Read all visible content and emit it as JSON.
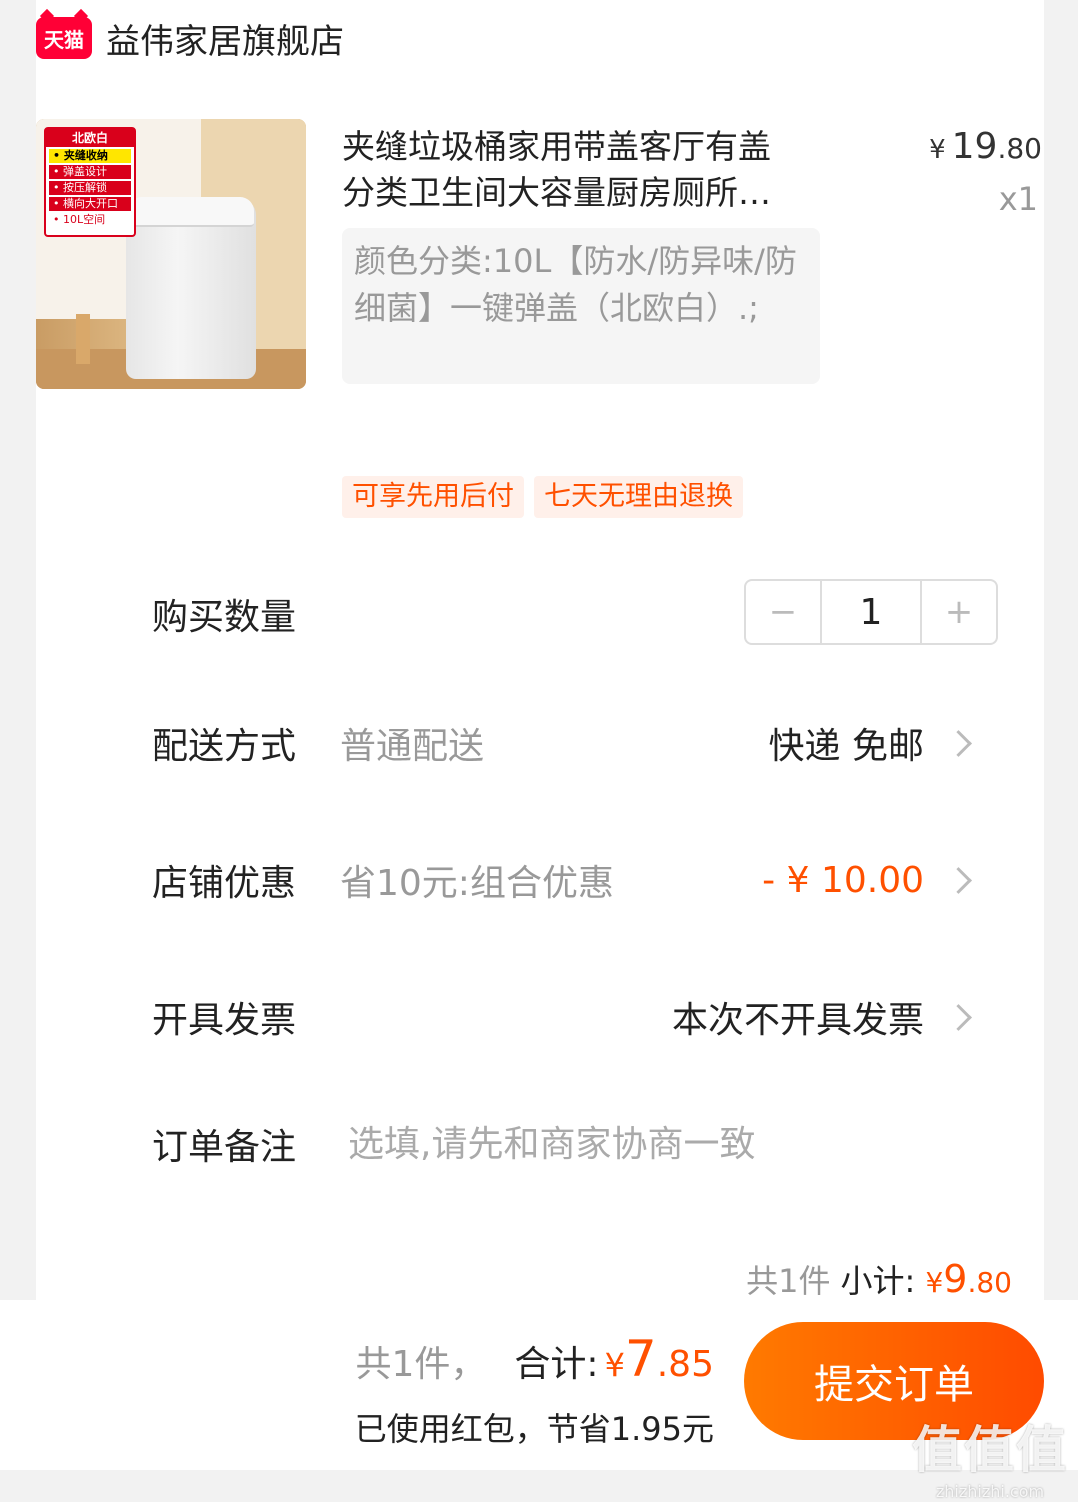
{
  "store": {
    "logo_text": "天猫",
    "name": "益伟家居旗舰店"
  },
  "product": {
    "image_tag": {
      "title": "北欧白",
      "lines": [
        "• 夹缝收纳",
        "• 弹盖设计",
        "• 按压解锁",
        "• 横向大开口",
        "• 10L空间"
      ]
    },
    "title_line1": "夹缝垃圾桶家用带盖客厅有盖",
    "title_line2": "分类卫生间大容量厨房厕所…",
    "price_currency": "¥",
    "price_int": "19",
    "price_dec": ".80",
    "quantity_label": "x1",
    "sku": "颜色分类:10L【防水/防异味/防细菌】一键弹盖（北欧白）.;",
    "tags": [
      "可享先用后付",
      "七天无理由退换"
    ]
  },
  "quantity": {
    "label": "购买数量",
    "minus": "−",
    "value": "1",
    "plus": "+"
  },
  "delivery": {
    "label": "配送方式",
    "desc": "普通配送",
    "value": "快递 免邮"
  },
  "discount": {
    "label": "店铺优惠",
    "desc": "省10元:组合优惠",
    "value": "- ¥ 10.00"
  },
  "invoice": {
    "label": "开具发票",
    "value": "本次不开具发票"
  },
  "note": {
    "label": "订单备注",
    "placeholder": "选填,请先和商家协商一致"
  },
  "subtotal": {
    "count": "共1件",
    "label": "小计:",
    "currency": "¥",
    "int": "9",
    "dec": ".80"
  },
  "footer": {
    "count": "共1件，",
    "total_label": "合计:",
    "currency": "¥",
    "int": "7",
    "dec": ".85",
    "savings": "已使用红包，节省1.95元",
    "submit": "提交订单"
  },
  "watermark": {
    "big": "值值值",
    "small": "zhizhizhi.com"
  },
  "colors": {
    "accent": "#ff5000",
    "tmall_red": "#ff0036"
  }
}
